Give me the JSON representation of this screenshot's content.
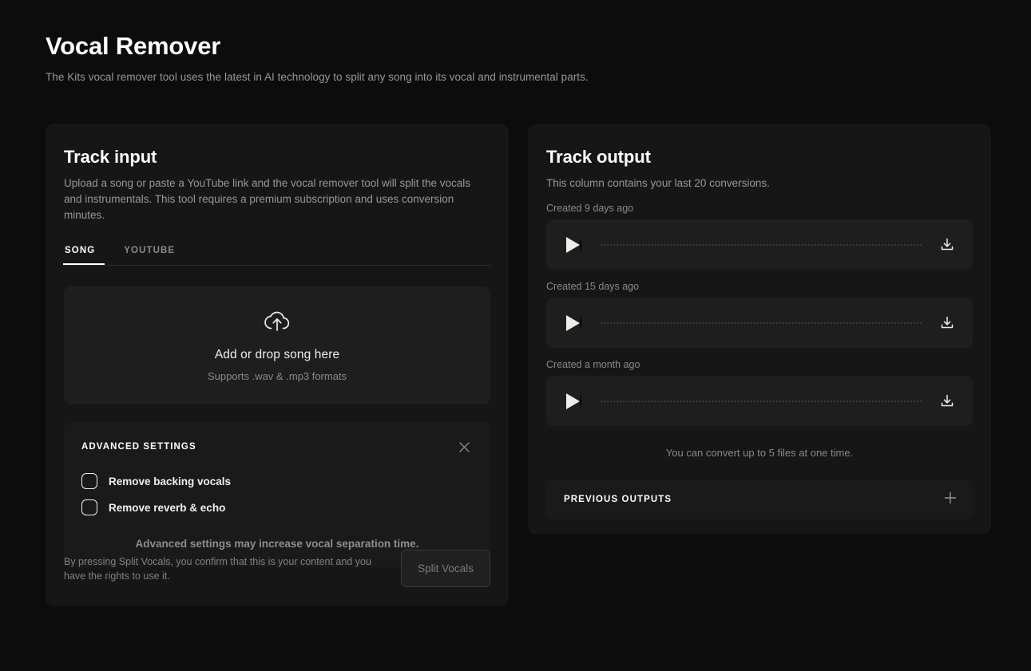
{
  "header": {
    "title": "Vocal Remover",
    "subtitle": "The Kits vocal remover tool uses the latest in AI technology to split any song into its vocal and instrumental parts."
  },
  "track_input": {
    "title": "Track input",
    "description": "Upload a song or paste a YouTube link and the vocal remover tool will split the vocals and instrumentals. This tool requires a premium subscription and uses conversion minutes.",
    "tabs": [
      {
        "label": "SONG",
        "active": true
      },
      {
        "label": "YOUTUBE",
        "active": false
      }
    ],
    "dropzone": {
      "icon": "cloud-upload-icon",
      "title": "Add or drop song here",
      "subtitle": "Supports .wav & .mp3 formats"
    },
    "advanced_settings": {
      "title": "ADVANCED SETTINGS",
      "close_icon": "close-icon",
      "options": [
        {
          "label": "Remove backing vocals",
          "checked": false
        },
        {
          "label": "Remove reverb & echo",
          "checked": false
        }
      ],
      "note": "Advanced settings may increase vocal separation time."
    },
    "footer": {
      "disclaimer": "By pressing Split Vocals, you confirm that this is your content and you have the rights to use it.",
      "split_button": "Split Vocals"
    }
  },
  "track_output": {
    "title": "Track output",
    "description": "This column contains your last 20 conversions.",
    "tracks": [
      {
        "created": "Created 9 days ago",
        "play_icon": "play-icon",
        "download_icon": "download-icon"
      },
      {
        "created": "Created 15 days ago",
        "play_icon": "play-icon",
        "download_icon": "download-icon"
      },
      {
        "created": "Created a month ago",
        "play_icon": "play-icon",
        "download_icon": "download-icon"
      }
    ],
    "convert_note": "You can convert up to 5 files at one time.",
    "previous_outputs": {
      "label": "PREVIOUS OUTPUTS",
      "expand_icon": "plus-icon"
    }
  },
  "colors": {
    "page_background": "#0c0c0c",
    "panel_background": "#161616",
    "surface": "#1e1e1e",
    "text_primary": "#ffffff",
    "text_muted": "#9b9792"
  }
}
